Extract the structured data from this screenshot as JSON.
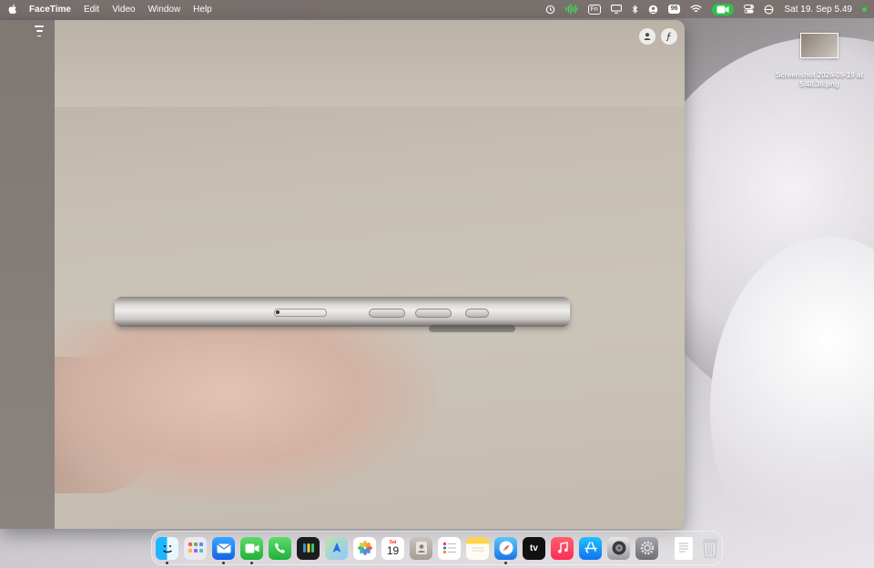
{
  "menubar": {
    "app_name": "FaceTime",
    "menus": [
      "Edit",
      "Video",
      "Window",
      "Help"
    ],
    "status": {
      "fn_badge": "Fn",
      "battery_percent": "96",
      "clock": "Sat 19. Sep  5.49"
    }
  },
  "desktop": {
    "file_name": "Screenshot 2026-09-19 at 5.48.36.png"
  },
  "dock": {
    "apps": [
      "Finder",
      "Launchpad",
      "Mail",
      "FaceTime",
      "Phone",
      "Passwords",
      "Maps",
      "Photos",
      "Calendar",
      "Contacts",
      "Reminders",
      "Notes",
      "Safari",
      "TV",
      "Music",
      "App Store",
      "Disk Utility",
      "System Settings"
    ],
    "calendar_day": "19",
    "calendar_month": "Sat",
    "tv_label": "tv",
    "others": [
      "TextEdit Document",
      "Trash"
    ]
  },
  "colors": {
    "facetime_green": "#30c04b",
    "menubar": "#786f6c"
  }
}
